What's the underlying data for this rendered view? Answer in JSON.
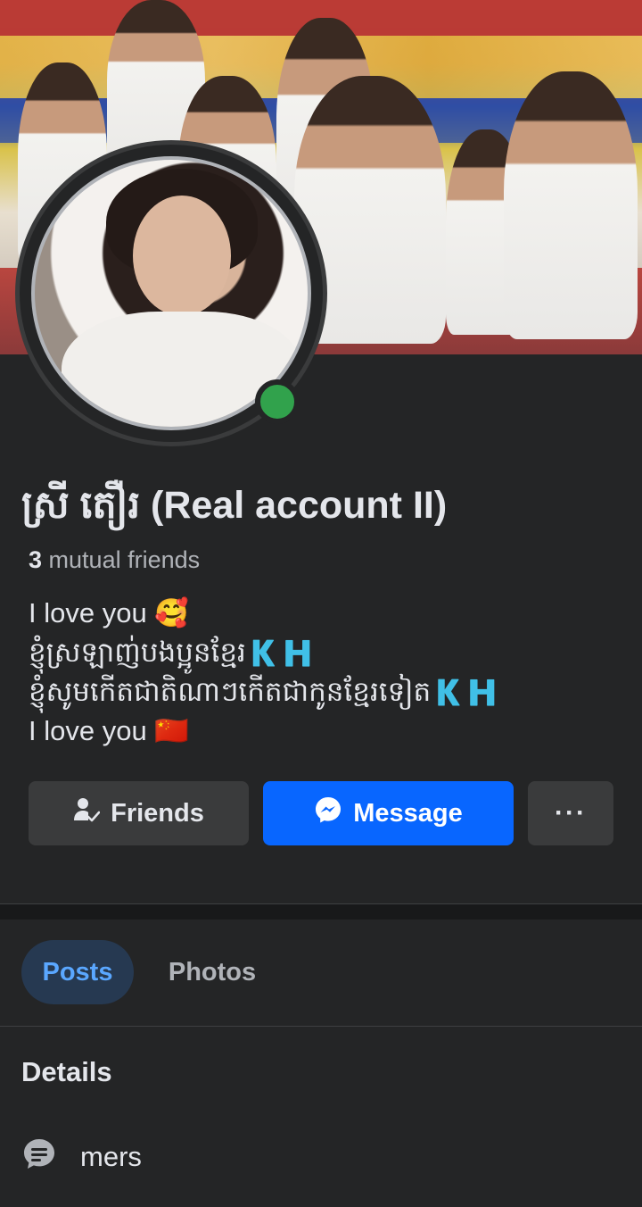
{
  "profile": {
    "name": "ស្រី តឿរ (Real account II)",
    "mutual_count": "3",
    "mutual_label": "mutual friends",
    "status": "online"
  },
  "bio": {
    "line1": "I love you 🥰",
    "line2": "ខ្ញុំស្រឡាញ់បងប្អូនខ្មែរ🇰🇭",
    "line3": "ខ្ញុំសូមកើតជាតិណាៗកើតជាកូនខ្មែរទៀត🇰🇭",
    "line4": "I love you 🇨🇳"
  },
  "actions": {
    "friends_label": "Friends",
    "message_label": "Message",
    "more_label": "···"
  },
  "tabs": [
    {
      "label": "Posts",
      "active": true
    },
    {
      "label": "Photos",
      "active": false
    }
  ],
  "details": {
    "heading": "Details",
    "items": [
      {
        "icon": "chat-bubble-icon",
        "text": "mers"
      }
    ]
  },
  "colors": {
    "background": "#242526",
    "accent": "#0866ff",
    "online": "#31a24c",
    "active_tab_bg": "#263951",
    "active_tab_text": "#5aa7ff"
  }
}
